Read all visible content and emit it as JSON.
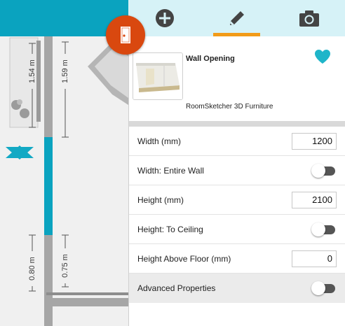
{
  "toolbar": {
    "tools": [
      {
        "icon": "add-icon"
      },
      {
        "icon": "edit-pencil-icon",
        "active": true
      },
      {
        "icon": "camera-icon"
      }
    ],
    "active_color": "#f29b19"
  },
  "floorplan": {
    "dimensions": [
      "1.54 m",
      "1.59 m",
      "0.80 m",
      "0.75 m"
    ],
    "selected_wall_color": "#0aa3bf"
  },
  "item": {
    "title": "Wall Opening",
    "source": "RoomSketcher 3D Furniture",
    "favorite_color": "#1fb5c9"
  },
  "properties": {
    "width_label": "Width (mm)",
    "width_value": "1200",
    "width_entire_wall_label": "Width: Entire Wall",
    "height_label": "Height (mm)",
    "height_value": "2100",
    "height_to_ceiling_label": "Height: To Ceiling",
    "height_above_floor_label": "Height Above Floor (mm)",
    "height_above_floor_value": "0",
    "advanced_label": "Advanced Properties"
  }
}
